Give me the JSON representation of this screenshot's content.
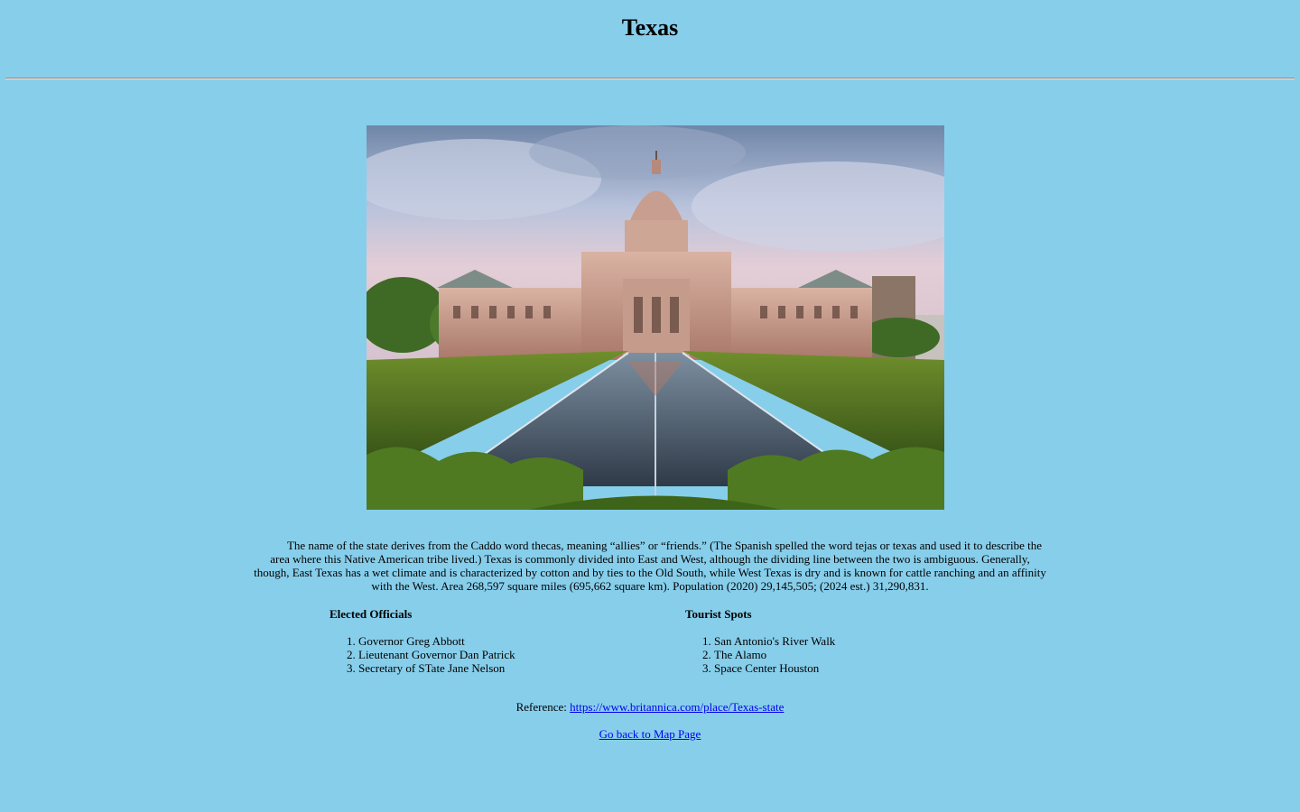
{
  "page": {
    "title": "Texas",
    "background_color": "#87ceeb"
  },
  "hero_image": {
    "alt": "Texas State Capitol building"
  },
  "intro": {
    "text": "The name of the state derives from the Caddo word thecas, meaning “allies” or “friends.” (The Spanish spelled the word tejas or texas and used it to describe the area where this Native American tribe lived.) Texas is commonly divided into East and West, although the dividing line between the two is ambiguous. Generally, though, East Texas has a wet climate and is characterized by cotton and by ties to the Old South, while West Texas is dry and is known for cattle ranching and an affinity with the West. Area 268,597 square miles (695,662 square km). Population (2020) 29,145,505; (2024 est.) 31,290,831."
  },
  "officials": {
    "heading": "Elected Officials",
    "items": [
      "Governor Greg Abbott",
      "Lieutenant Governor Dan Patrick",
      "Secretary of STate Jane Nelson"
    ]
  },
  "tourist": {
    "heading": "Tourist Spots",
    "items": [
      "San Antonio's River Walk",
      "The Alamo",
      "Space Center Houston"
    ]
  },
  "reference": {
    "label": "Reference:",
    "link_text": "https://www.britannica.com/place/Texas-state",
    "link_color": "#0000ee"
  },
  "back_link": {
    "text": "Go back to Map Page"
  }
}
